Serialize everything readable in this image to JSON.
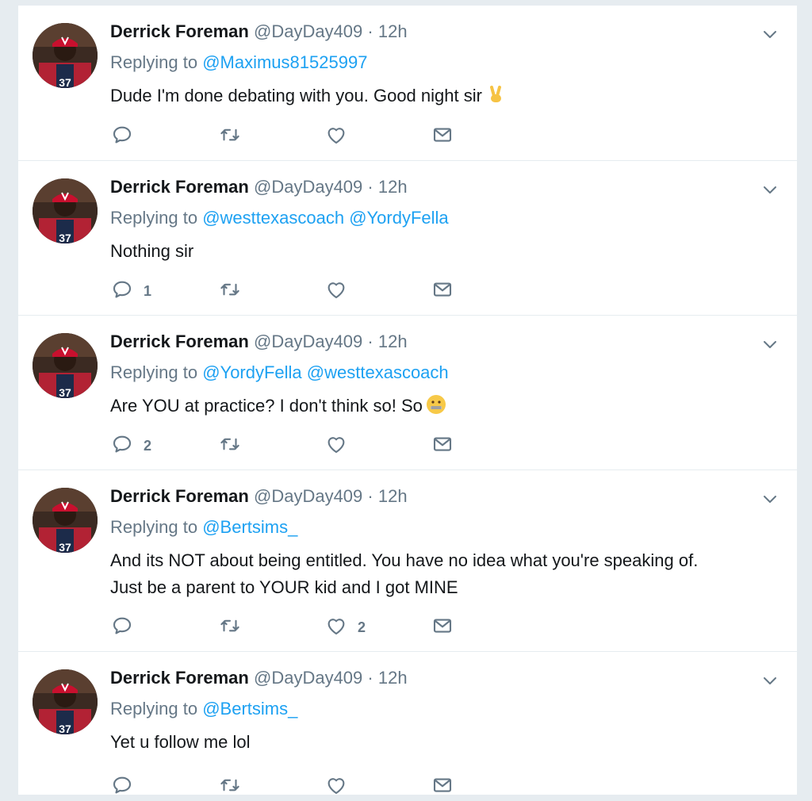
{
  "tweets": [
    {
      "name": "Derrick Foreman",
      "handle": "@DayDay409",
      "sep": "·",
      "time": "12h",
      "replying_prefix": "Replying to",
      "mentions": [
        "@Maximus81525997"
      ],
      "text_lines": [
        "Dude I'm done debating with you. Good night sir"
      ],
      "emoji": "victory-hand",
      "reply_count": "",
      "like_count": ""
    },
    {
      "name": "Derrick Foreman",
      "handle": "@DayDay409",
      "sep": "·",
      "time": "12h",
      "replying_prefix": "Replying to",
      "mentions": [
        "@westtexascoach",
        "@YordyFella"
      ],
      "text_lines": [
        "Nothing sir"
      ],
      "emoji": "",
      "reply_count": "1",
      "like_count": ""
    },
    {
      "name": "Derrick Foreman",
      "handle": "@DayDay409",
      "sep": "·",
      "time": "12h",
      "replying_prefix": "Replying to",
      "mentions": [
        "@YordyFella",
        "@westtexascoach"
      ],
      "text_lines": [
        "Are YOU at practice? I don't think so! So"
      ],
      "emoji": "zipper-mouth-face",
      "reply_count": "2",
      "like_count": ""
    },
    {
      "name": "Derrick Foreman",
      "handle": "@DayDay409",
      "sep": "·",
      "time": "12h",
      "replying_prefix": "Replying to",
      "mentions": [
        "@Bertsims_"
      ],
      "text_lines": [
        "And its NOT about being entitled. You have no idea what you're speaking of.",
        "Just be a parent to YOUR kid and I got MINE"
      ],
      "emoji": "",
      "reply_count": "",
      "like_count": "2"
    },
    {
      "name": "Derrick Foreman",
      "handle": "@DayDay409",
      "sep": "·",
      "time": "12h",
      "replying_prefix": "Replying to",
      "mentions": [
        "@Bertsims_"
      ],
      "text_lines": [
        "Yet u follow me lol"
      ],
      "emoji": "",
      "reply_count": "",
      "like_count": ""
    }
  ],
  "icons": {
    "reply": "reply-icon",
    "retweet": "retweet-icon",
    "like": "heart-icon",
    "dm": "envelope-icon",
    "caret": "chevron-down-icon"
  },
  "colors": {
    "link": "#1da1f2",
    "secondary": "#657786",
    "divider": "#e6ecf0"
  }
}
